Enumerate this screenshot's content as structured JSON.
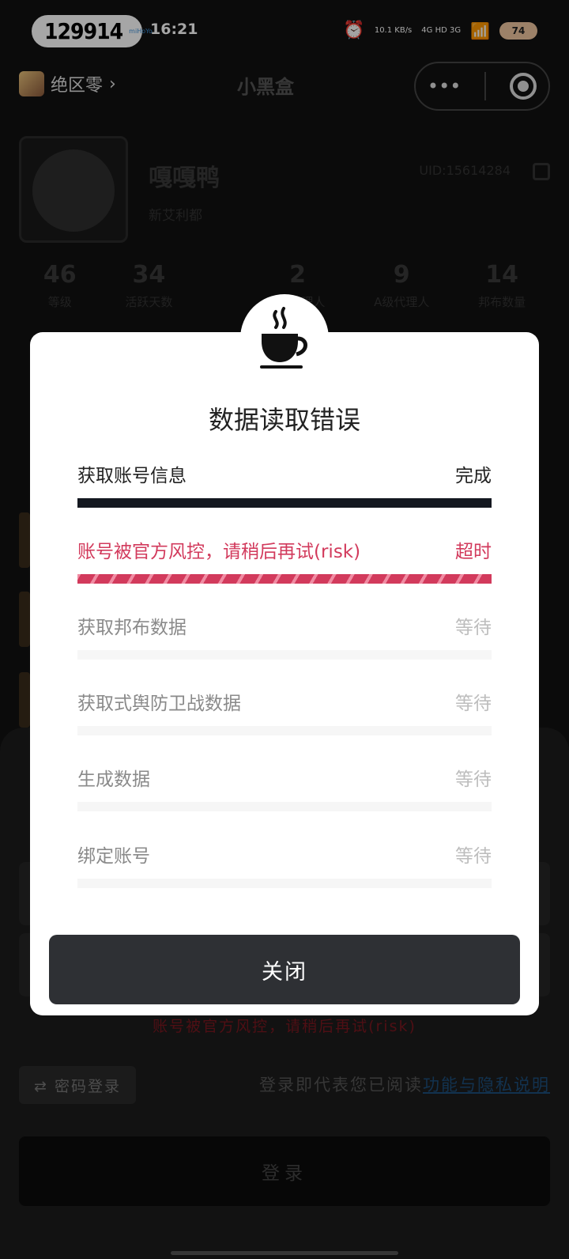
{
  "status_bar": {
    "pill_number": "129914",
    "pill_brand": "miHoYo",
    "time": "16:21",
    "net_speed": "10.1 KB/s",
    "network": "4G HD 3G",
    "battery": "74"
  },
  "topbar": {
    "game": "绝区零",
    "logo": "小黑盒",
    "more": "•••"
  },
  "profile": {
    "nickname": "嘎嘎鸭",
    "server": "新艾利都",
    "uid": "UID:15614284"
  },
  "stats": [
    {
      "value": "46",
      "label": "等级"
    },
    {
      "value": "34",
      "label": "活跃天数"
    },
    {
      "value": "",
      "label": ""
    },
    {
      "value": "2",
      "label": "S级代理人"
    },
    {
      "value": "9",
      "label": "A级代理人"
    },
    {
      "value": "14",
      "label": "邦布数量"
    }
  ],
  "dialog": {
    "title": "数据读取错误",
    "steps": [
      {
        "label": "获取账号信息",
        "state": "完成",
        "status": "done"
      },
      {
        "label": "账号被官方风控，请稍后再试(risk)",
        "state": "超时",
        "status": "error"
      },
      {
        "label": "获取邦布数据",
        "state": "等待",
        "status": "wait"
      },
      {
        "label": "获取式舆防卫战数据",
        "state": "等待",
        "status": "wait"
      },
      {
        "label": "生成数据",
        "state": "等待",
        "status": "wait"
      },
      {
        "label": "绑定账号",
        "state": "等待",
        "status": "wait"
      }
    ],
    "close_label": "关闭"
  },
  "sheet": {
    "error_text": "账号被官方风控，请稍后再试(risk)",
    "pwd_login": "⇄ 密码登录",
    "agree_prefix": "登录即代表您已阅读",
    "agree_link": "功能与隐私说明",
    "login_label": "登录"
  }
}
